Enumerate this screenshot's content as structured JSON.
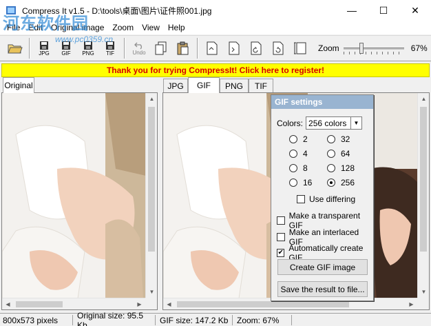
{
  "window": {
    "title": "Compress It v1.5 - D:\\tools\\桌面\\图片\\证件照001.jpg",
    "minimize": "—",
    "maximize": "☐",
    "close": "✕"
  },
  "watermark": {
    "text": "河东软件园",
    "url": "www.pc0359.cn"
  },
  "menu": [
    "File",
    "Edit",
    "Original image",
    "Zoom",
    "View",
    "Help"
  ],
  "toolbar": {
    "jpg_label": "JPG",
    "gif_label": "GIF",
    "png_label": "PNG",
    "tif_label": "TIF",
    "undo_label": "Undo",
    "zoom_label": "Zoom",
    "zoom_value": "67%",
    "zoom_fraction": 0.28
  },
  "banner": {
    "text": "Thank you for trying CompressIt! Click here to register!"
  },
  "tabs": {
    "original": "Original",
    "formats": [
      "JPG",
      "GIF",
      "PNG",
      "TIF"
    ],
    "active_format": "GIF"
  },
  "gif_settings": {
    "title": "GIF settings",
    "colors_label": "Colors:",
    "colors_value": "256 colors",
    "options": [
      "2",
      "32",
      "4",
      "64",
      "8",
      "128",
      "16",
      "256"
    ],
    "selected": "256",
    "use_dithering": {
      "label": "Use differing",
      "checked": false
    },
    "transparent": {
      "label": "Make a transparent GIF",
      "checked": false
    },
    "interlaced": {
      "label": "Make an interlaced GIF",
      "checked": false
    },
    "auto_create": {
      "label": "Automatically create GIF",
      "checked": true
    },
    "create_button": "Create GIF image",
    "save_button": "Save the result to file..."
  },
  "status": {
    "dimensions": "800x573 pixels",
    "original_size": "Original size: 95.5 Kb",
    "gif_size": "GIF size: 147.2 Kb",
    "zoom": "Zoom: 67%"
  },
  "colors": {
    "banner_bg": "#ffff00",
    "banner_text": "#d40000",
    "panel_header": "#99b4d1"
  }
}
